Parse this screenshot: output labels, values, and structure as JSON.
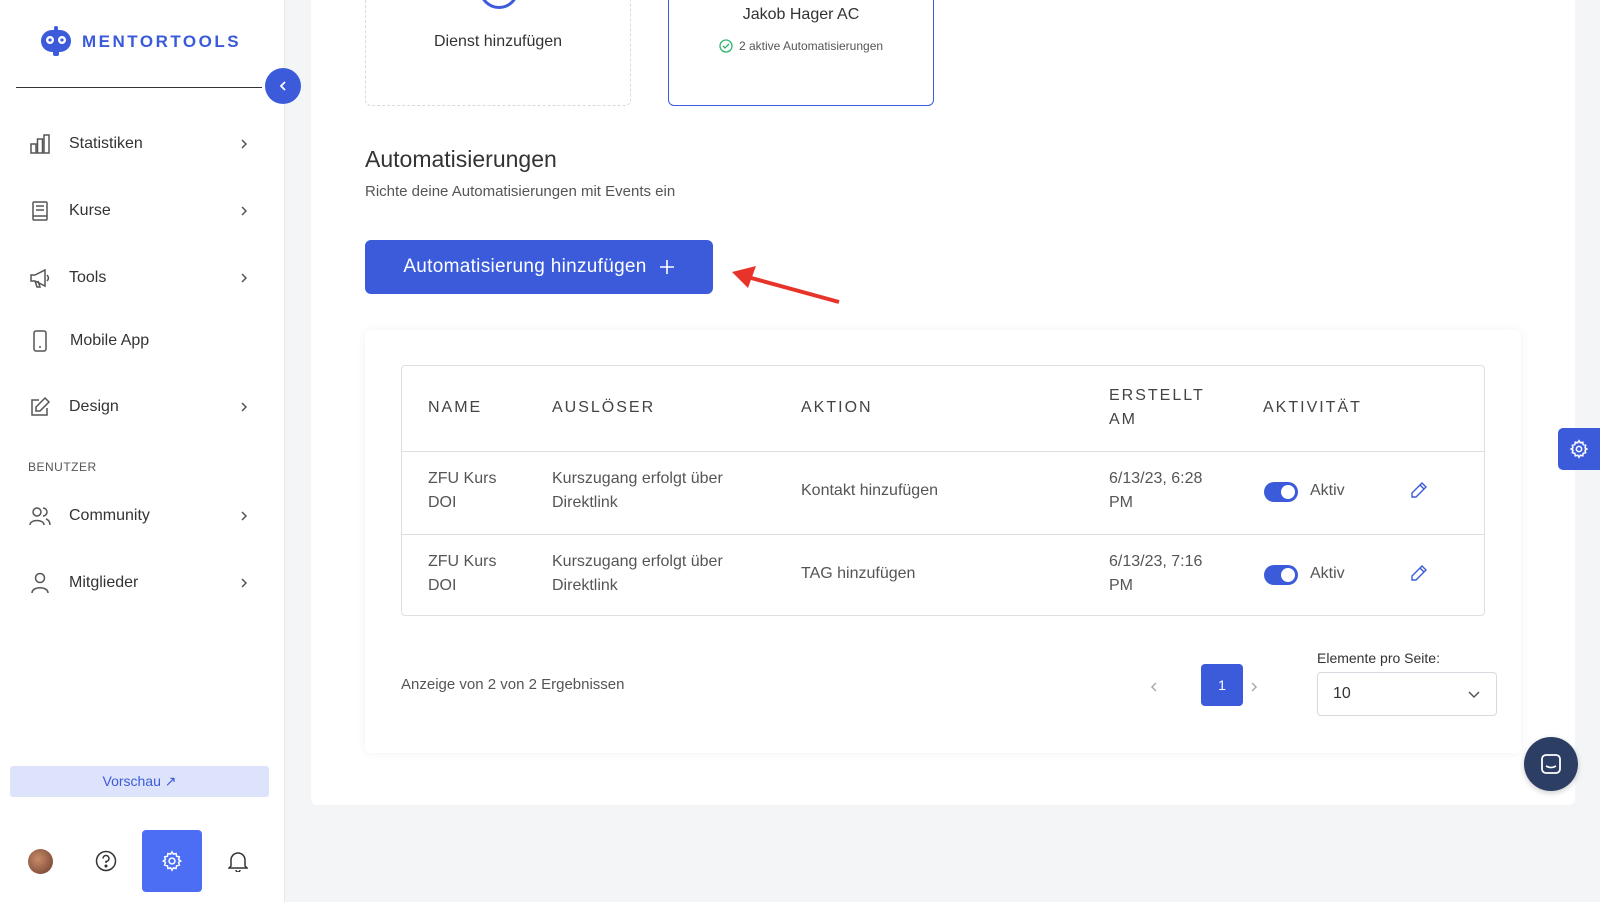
{
  "brand": {
    "name": "MENTORTOOLS",
    "accent": "#3b5bdb"
  },
  "sidebar": {
    "items": [
      {
        "label": "Statistiken",
        "icon": "bar-chart-icon",
        "has_chevron": true
      },
      {
        "label": "Kurse",
        "icon": "book-icon",
        "has_chevron": true
      },
      {
        "label": "Tools",
        "icon": "megaphone-icon",
        "has_chevron": true
      },
      {
        "label": "Mobile App",
        "icon": "phone-icon",
        "has_chevron": false
      },
      {
        "label": "Design",
        "icon": "pencil-square-icon",
        "has_chevron": true
      }
    ],
    "section_users": "BENUTZER",
    "user_items": [
      {
        "label": "Community",
        "icon": "users-icon",
        "has_chevron": true
      },
      {
        "label": "Mitglieder",
        "icon": "user-icon",
        "has_chevron": true
      }
    ],
    "preview_label": "Vorschau ↗"
  },
  "services": {
    "add_label": "Dienst hinzufügen",
    "active_title": "Jakob Hager AC",
    "active_status": "2 aktive Automatisierungen"
  },
  "automations": {
    "title": "Automatisierungen",
    "subtitle": "Richte deine Automatisierungen mit Events ein",
    "add_button": "Automatisierung hinzufügen",
    "columns": {
      "name": "NAME",
      "trigger": "AUSLÖSER",
      "action": "AKTION",
      "created_line1": "ERSTELLT",
      "created_line2": "AM",
      "activity": "AKTIVITÄT"
    },
    "rows": [
      {
        "name_line1": "ZFU Kurs",
        "name_line2": "DOI",
        "trigger_line1": "Kurszugang erfolgt über",
        "trigger_line2": "Direktlink",
        "action": "Kontakt hinzufügen",
        "created_line1": "6/13/23, 6:28",
        "created_line2": "PM",
        "status": "Aktiv"
      },
      {
        "name_line1": "ZFU Kurs",
        "name_line2": "DOI",
        "trigger_line1": "Kurszugang erfolgt über",
        "trigger_line2": "Direktlink",
        "action": "TAG hinzufügen",
        "created_line1": "6/13/23, 7:16",
        "created_line2": "PM",
        "status": "Aktiv"
      }
    ],
    "results_text": "Anzeige von 2 von 2 Ergebnissen",
    "current_page": "1",
    "per_page_label": "Elemente pro Seite:",
    "per_page_value": "10"
  }
}
